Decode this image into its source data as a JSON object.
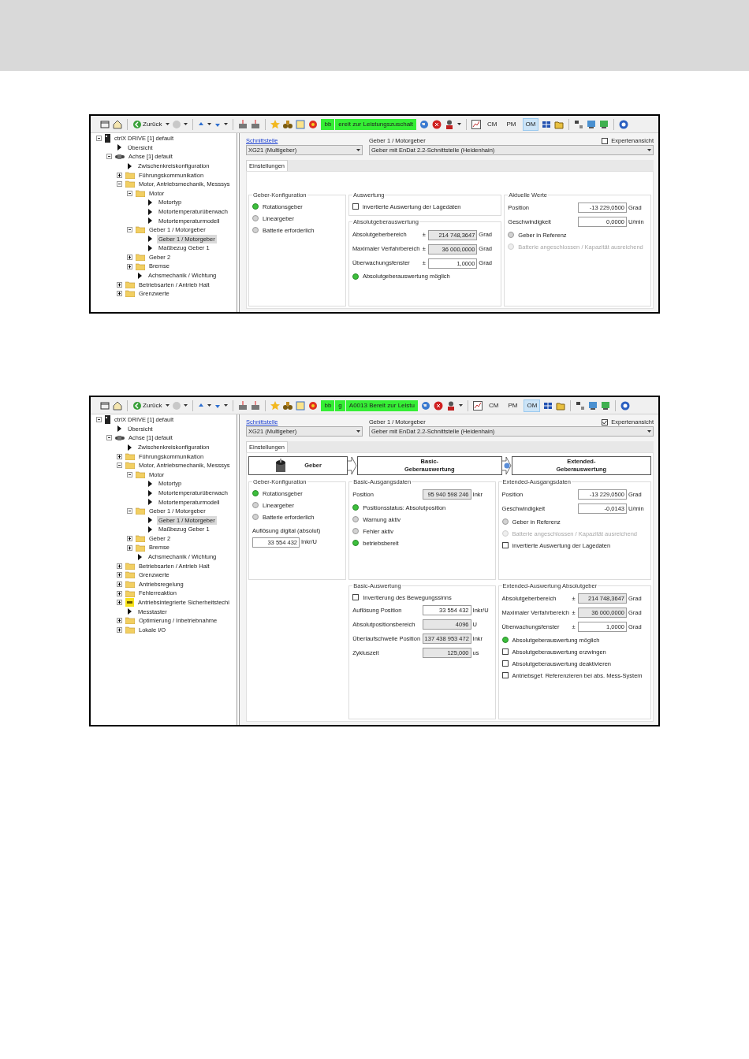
{
  "screens": [
    {
      "toolbar": {
        "back_label": "Zurück",
        "status": [
          "bb",
          "ereit zur Leistungszuschalt"
        ],
        "modes": [
          {
            "label": "CM",
            "selected": false
          },
          {
            "label": "PM",
            "selected": false
          },
          {
            "label": "OM",
            "selected": true
          }
        ]
      },
      "tree": [
        {
          "label": "ctrlX DRIVE [1] default",
          "kind": "drive",
          "expanded": true,
          "selected": false,
          "children": [
            {
              "label": "Übersicht",
              "kind": "leaf",
              "selected": false
            },
            {
              "label": "Achse [1] default",
              "kind": "axis",
              "expanded": true,
              "selected": false,
              "children": [
                {
                  "label": "Zwischenkreiskonfiguration",
                  "kind": "leaf",
                  "selected": false
                },
                {
                  "label": "Führungskommunikation",
                  "kind": "folder",
                  "expanded": false,
                  "selected": false
                },
                {
                  "label": "Motor, Antriebsmechanik, Messsys",
                  "kind": "folder",
                  "expanded": true,
                  "selected": false,
                  "children": [
                    {
                      "label": "Motor",
                      "kind": "folder",
                      "expanded": true,
                      "selected": false,
                      "children": [
                        {
                          "label": "Motortyp",
                          "kind": "leaf",
                          "selected": false
                        },
                        {
                          "label": "Motortemperaturüberwach",
                          "kind": "leaf",
                          "selected": false
                        },
                        {
                          "label": "Motortemperaturmodell",
                          "kind": "leaf",
                          "selected": false
                        }
                      ]
                    },
                    {
                      "label": "Geber 1 / Motorgeber",
                      "kind": "folder",
                      "expanded": true,
                      "selected": false,
                      "children": [
                        {
                          "label": "Geber 1 / Motorgeber",
                          "kind": "leaf",
                          "selected": true
                        },
                        {
                          "label": "Maßbezug Geber 1",
                          "kind": "leaf",
                          "selected": false
                        }
                      ]
                    },
                    {
                      "label": "Geber 2",
                      "kind": "folder",
                      "expanded": false,
                      "selected": false
                    },
                    {
                      "label": "Bremse",
                      "kind": "folder",
                      "expanded": false,
                      "selected": false
                    },
                    {
                      "label": "Achsmechanik / Wichtung",
                      "kind": "leaf",
                      "selected": false
                    }
                  ]
                },
                {
                  "label": "Betriebsarten / Antrieb Halt",
                  "kind": "folder",
                  "expanded": false,
                  "selected": false
                },
                {
                  "label": "Grenzwerte",
                  "kind": "folder",
                  "expanded": false,
                  "selected": false
                }
              ]
            }
          ]
        }
      ],
      "interface": {
        "link": "Schnittstelle",
        "value": "XG21 (Multigeber)"
      },
      "encoder": {
        "label": "Geber 1 / Motorgeber",
        "value": "Geber mit EnDat 2.2-Schnittstelle (Heidenhain)"
      },
      "expert_view": {
        "label": "Expertenansicht",
        "checked": false
      },
      "tabs": [
        {
          "label": "Einstellungen",
          "selected": true
        }
      ],
      "columns": [
        [
          {
            "title": "Geber-Konfiguration",
            "items": [
              {
                "kind": "led",
                "label": "Rotationsgeber",
                "on": true
              },
              {
                "kind": "led",
                "label": "Lineargeber",
                "on": false
              },
              {
                "kind": "led",
                "label": "Batterie erforderlich",
                "on": false
              }
            ]
          }
        ],
        [
          {
            "title": "Auswertung",
            "items": [
              {
                "kind": "checkbox",
                "label": "invertierte Auswertung der Lagedaten",
                "checked": false
              }
            ]
          },
          {
            "title": "Absolutgeberauswertung",
            "items": [
              {
                "kind": "field",
                "label": "Absolutgeberbereich",
                "sign": "±",
                "value": "214 748,3647",
                "unit": "Grad",
                "readonly": true
              },
              {
                "kind": "field",
                "label": "Maximaler Verfahrbereich",
                "sign": "±",
                "value": "36 000,0000",
                "unit": "Grad",
                "readonly": true
              },
              {
                "kind": "field",
                "label": "Überwachungsfenster",
                "sign": "±",
                "value": "1,0000",
                "unit": "Grad",
                "readonly": false
              },
              {
                "kind": "led",
                "label": "Absolutgeberauswertung möglich",
                "on": true
              }
            ]
          }
        ],
        [
          {
            "title": "Aktuelle Werte",
            "items": [
              {
                "kind": "field",
                "label": "Position",
                "value": "-13 229,0500",
                "unit": "Grad",
                "readonly": false
              },
              {
                "kind": "field",
                "label": "Geschwindigkeit",
                "value": "0,0000",
                "unit": "U/min",
                "readonly": false
              },
              {
                "kind": "led",
                "label": "Geber in Referenz",
                "on": false
              },
              {
                "kind": "led",
                "label": "Batterie angeschlossen / Kapazität ausreichend",
                "on": false,
                "disabled": true
              }
            ]
          }
        ]
      ]
    },
    {
      "toolbar": {
        "back_label": "Zurück",
        "status": [
          "bb",
          "g",
          "A0013 Bereit zur Leistu"
        ],
        "modes": [
          {
            "label": "CM",
            "selected": false
          },
          {
            "label": "PM",
            "selected": false
          },
          {
            "label": "OM",
            "selected": true
          }
        ]
      },
      "tree": [
        {
          "label": "ctrlX DRIVE [1] default",
          "kind": "drive",
          "expanded": true,
          "selected": false,
          "children": [
            {
              "label": "Übersicht",
              "kind": "leaf",
              "selected": false
            },
            {
              "label": "Achse [1] default",
              "kind": "axis",
              "expanded": true,
              "selected": false,
              "children": [
                {
                  "label": "Zwischenkreiskonfiguration",
                  "kind": "leaf",
                  "selected": false
                },
                {
                  "label": "Führungskommunikation",
                  "kind": "folder",
                  "expanded": false,
                  "selected": false
                },
                {
                  "label": "Motor, Antriebsmechanik, Messsys",
                  "kind": "folder",
                  "expanded": true,
                  "selected": false,
                  "children": [
                    {
                      "label": "Motor",
                      "kind": "folder",
                      "expanded": true,
                      "selected": false,
                      "children": [
                        {
                          "label": "Motortyp",
                          "kind": "leaf",
                          "selected": false
                        },
                        {
                          "label": "Motortemperaturüberwach",
                          "kind": "leaf",
                          "selected": false
                        },
                        {
                          "label": "Motortemperaturmodell",
                          "kind": "leaf",
                          "selected": false
                        }
                      ]
                    },
                    {
                      "label": "Geber 1 / Motorgeber",
                      "kind": "folder",
                      "expanded": true,
                      "selected": false,
                      "children": [
                        {
                          "label": "Geber 1 / Motorgeber",
                          "kind": "leaf",
                          "selected": true
                        },
                        {
                          "label": "Maßbezug Geber 1",
                          "kind": "leaf",
                          "selected": false
                        }
                      ]
                    },
                    {
                      "label": "Geber 2",
                      "kind": "folder",
                      "expanded": false,
                      "selected": false
                    },
                    {
                      "label": "Bremse",
                      "kind": "folder",
                      "expanded": false,
                      "selected": false
                    },
                    {
                      "label": "Achsmechanik / Wichtung",
                      "kind": "leaf",
                      "selected": false
                    }
                  ]
                },
                {
                  "label": "Betriebsarten / Antrieb Halt",
                  "kind": "folder",
                  "expanded": false,
                  "selected": false
                },
                {
                  "label": "Grenzwerte",
                  "kind": "folder",
                  "expanded": false,
                  "selected": false
                },
                {
                  "label": "Antriebsregelung",
                  "kind": "folder",
                  "expanded": false,
                  "selected": false
                },
                {
                  "label": "Fehlerreaktion",
                  "kind": "folder",
                  "expanded": false,
                  "selected": false
                },
                {
                  "label": "Antriebsintegrierte Sicherheitstechi",
                  "kind": "safety",
                  "expanded": false,
                  "selected": false
                },
                {
                  "label": "Messtaster",
                  "kind": "leaf",
                  "selected": false
                },
                {
                  "label": "Optimierung / Inbetriebnahme",
                  "kind": "folder",
                  "expanded": false,
                  "selected": false
                },
                {
                  "label": "Lokale I/O",
                  "kind": "folder",
                  "expanded": false,
                  "selected": false
                }
              ]
            }
          ]
        }
      ],
      "interface": {
        "link": "Schnittstelle",
        "value": "XG21 (Multigeber)"
      },
      "encoder": {
        "label": "Geber 1 / Motorgeber",
        "value": "Geber mit EnDat 2.2-Schnittstelle (Heidenhain)"
      },
      "expert_view": {
        "label": "Expertenansicht",
        "checked": true
      },
      "tabs": [
        {
          "label": "Einstellungen",
          "selected": true
        }
      ],
      "flow": [
        {
          "lines": [
            "Geber"
          ],
          "kind": "encoder"
        },
        {
          "lines": [
            "Basic-",
            "Geberauswertung"
          ],
          "kind": "stage"
        },
        {
          "lines": [
            "Extended-",
            "Geberauswertung"
          ],
          "kind": "stage"
        }
      ],
      "columns": [
        [
          {
            "title": "Geber-Konfiguration",
            "items": [
              {
                "kind": "led",
                "label": "Rotationsgeber",
                "on": true
              },
              {
                "kind": "led",
                "label": "Lineargeber",
                "on": false
              },
              {
                "kind": "led",
                "label": "Batterie erforderlich",
                "on": false
              },
              {
                "kind": "stacked_field",
                "label": "Auflösung digital (absolut)",
                "value": "33 554 432",
                "unit": "Inkr/U",
                "readonly": false
              }
            ]
          }
        ],
        [
          {
            "title": "Basic-Ausgangsdaten",
            "items": [
              {
                "kind": "field",
                "label": "Position",
                "value": "95 940 598 246",
                "unit": "Inkr",
                "readonly": true
              },
              {
                "kind": "led",
                "label": "Positionsstatus: Absolutposition",
                "on": true
              },
              {
                "kind": "led",
                "label": "Warnung aktiv",
                "on": false
              },
              {
                "kind": "led",
                "label": "Fehler aktiv",
                "on": false
              },
              {
                "kind": "led",
                "label": "betriebsbereit",
                "on": true
              }
            ]
          },
          {
            "title": "Basic-Auswertung",
            "items": [
              {
                "kind": "checkbox",
                "label": "Invertierung des Bewegungssinns",
                "checked": false
              },
              {
                "kind": "field",
                "label": "Auflösung Position",
                "value": "33 554 432",
                "unit": "Inkr/U",
                "readonly": false
              },
              {
                "kind": "field",
                "label": "Absolutpositionsbereich",
                "value": "4096",
                "unit": "U",
                "readonly": true
              },
              {
                "kind": "field",
                "label": "Überlaufschwelle Position",
                "value": "137 438 953 472",
                "unit": "Inkr",
                "readonly": true
              },
              {
                "kind": "field",
                "label": "Zykluszeit",
                "value": "125,000",
                "unit": "us",
                "readonly": true
              }
            ]
          }
        ],
        [
          {
            "title": "Extended-Ausgangsdaten",
            "items": [
              {
                "kind": "field",
                "label": "Position",
                "value": "-13 229,0500",
                "unit": "Grad",
                "readonly": false
              },
              {
                "kind": "field",
                "label": "Geschwindigkeit",
                "value": "-0,0143",
                "unit": "U/min",
                "readonly": false
              },
              {
                "kind": "led",
                "label": "Geber in Referenz",
                "on": false
              },
              {
                "kind": "led",
                "label": "Batterie angeschlossen / Kapazität ausreichend",
                "on": false,
                "disabled": true
              },
              {
                "kind": "checkbox",
                "label": "invertierte Auswertung der Lagedaten",
                "checked": false
              }
            ]
          },
          {
            "title": "Extended-Auswertung Absolutgeber",
            "items": [
              {
                "kind": "field",
                "label": "Absolutgeberbereich",
                "sign": "±",
                "value": "214 748,3647",
                "unit": "Grad",
                "readonly": true
              },
              {
                "kind": "field",
                "label": "Maximaler Verfahrbereich",
                "sign": "±",
                "value": "36 000,0000",
                "unit": "Grad",
                "readonly": true
              },
              {
                "kind": "field",
                "label": "Überwachungsfenster",
                "sign": "±",
                "value": "1,0000",
                "unit": "Grad",
                "readonly": false
              },
              {
                "kind": "led",
                "label": "Absolutgeberauswertung möglich",
                "on": true
              },
              {
                "kind": "checkbox",
                "label": "Absolutgeberauswertung erzwingen",
                "checked": false
              },
              {
                "kind": "checkbox",
                "label": "Absolutgeberauswertung deaktivieren",
                "checked": false
              },
              {
                "kind": "checkbox",
                "label": "Antriebsgef. Referenzieren bei abs. Mess-System",
                "checked": false
              }
            ]
          }
        ]
      ]
    }
  ]
}
